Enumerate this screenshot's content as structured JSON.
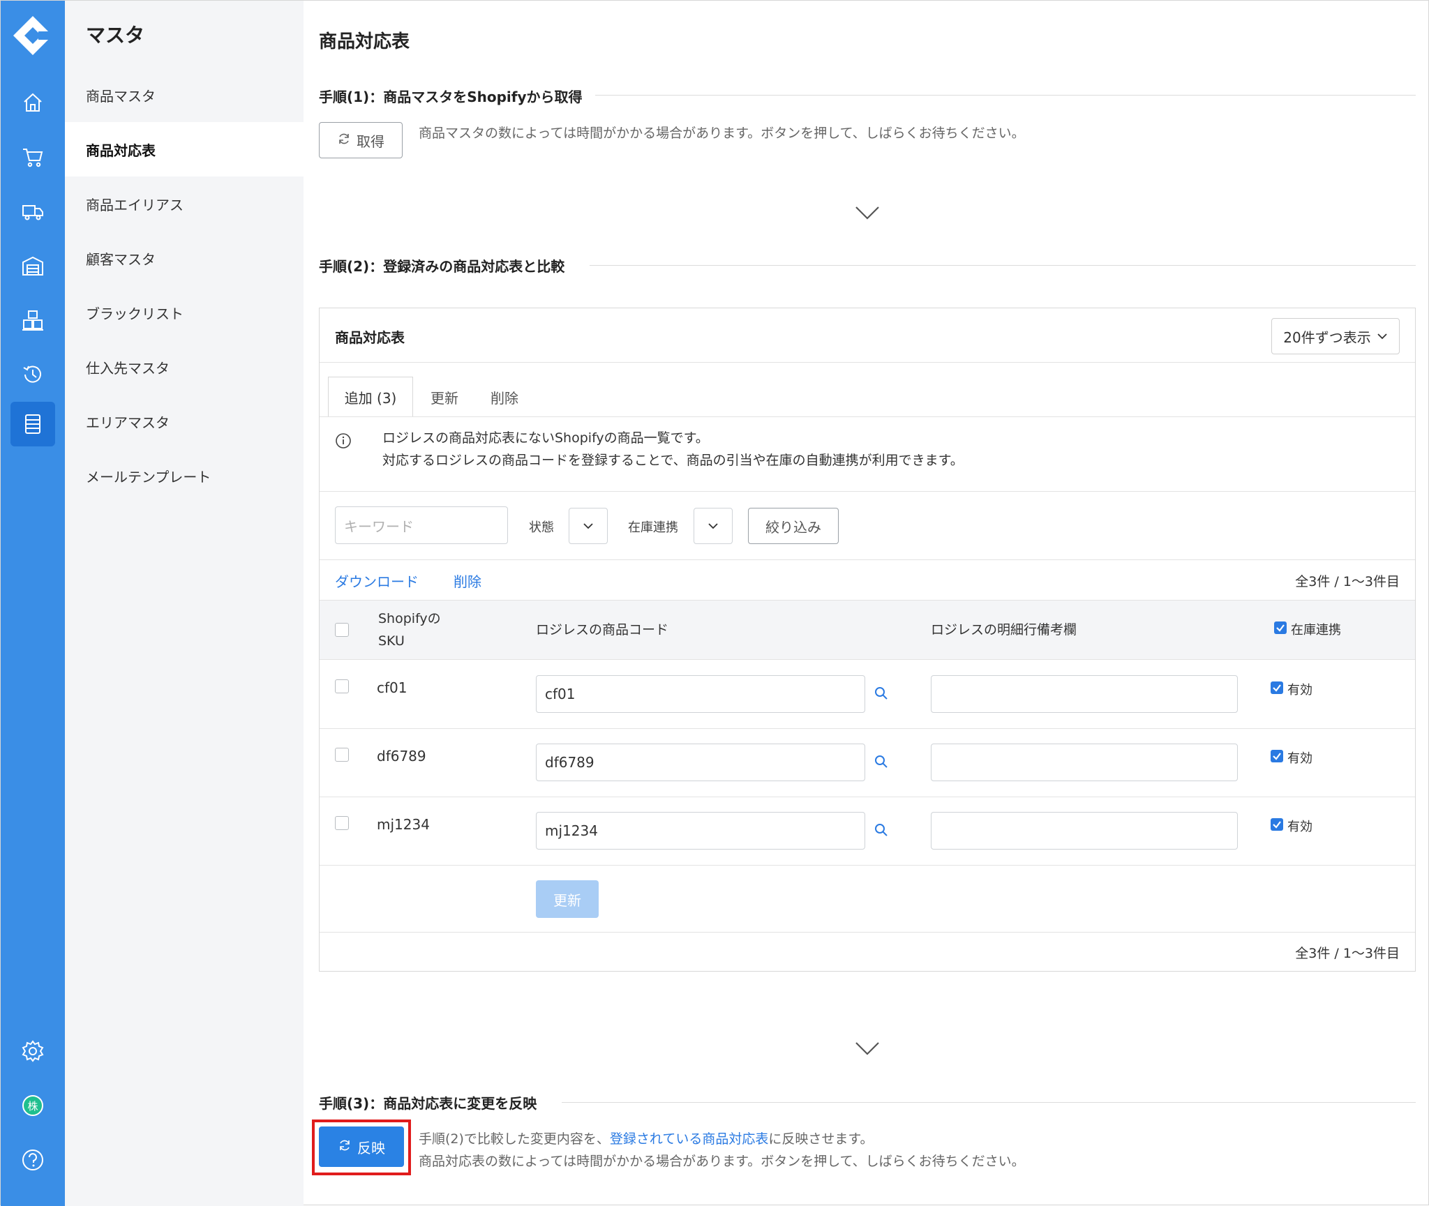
{
  "menu": {
    "title": "マスタ",
    "items": [
      {
        "label": "商品マスタ"
      },
      {
        "label": "商品対応表"
      },
      {
        "label": "商品エイリアス"
      },
      {
        "label": "顧客マスタ"
      },
      {
        "label": "ブラックリスト"
      },
      {
        "label": "仕入先マスタ"
      },
      {
        "label": "エリアマスタ"
      },
      {
        "label": "メールテンプレート"
      }
    ]
  },
  "rail": {
    "avatar_text": "株",
    "icons": [
      "home-icon",
      "cart-icon",
      "truck-icon",
      "warehouse-icon",
      "boxes-icon",
      "history-icon",
      "list-icon",
      "gear-icon",
      "help-icon"
    ]
  },
  "page": {
    "title": "商品対応表",
    "step1": {
      "heading": "手順(1)：商品マスタをShopifyから取得",
      "button": "取得",
      "note": "商品マスタの数によっては時間がかかる場合があります。ボタンを押して、しばらくお待ちください。"
    },
    "step2": {
      "heading": "手順(2)：登録済みの商品対応表と比較"
    },
    "step3": {
      "heading": "手順(3)：商品対応表に変更を反映",
      "button": "反映",
      "note_prefix": "手順(2)で比較した変更内容を、",
      "note_link": "登録されている商品対応表",
      "note_suffix": "に反映させます。",
      "note_line2": "商品対応表の数によっては時間がかかる場合があります。ボタンを押して、しばらくお待ちください。"
    }
  },
  "panel": {
    "title": "商品対応表",
    "per_page": "20件ずつ表示",
    "tabs": [
      {
        "label": "追加 (3)"
      },
      {
        "label": "更新"
      },
      {
        "label": "削除"
      }
    ],
    "info_line1": "ロジレスの商品対応表にないShopifyの商品一覧です。",
    "info_line2": "対応するロジレスの商品コードを登録することで、商品の引当や在庫の自動連携が利用できます。",
    "filter": {
      "keyword_placeholder": "キーワード",
      "status_label": "状態",
      "stock_label": "在庫連携",
      "filter_button": "絞り込み"
    },
    "actions": {
      "download": "ダウンロード",
      "delete": "削除"
    },
    "count_text": "全3件 / 1〜3件目",
    "columns": {
      "sku_line1": "Shopifyの",
      "sku_line2": "SKU",
      "code": "ロジレスの商品コード",
      "remark": "ロジレスの明細行備考欄",
      "stock": "在庫連携"
    },
    "rows": [
      {
        "sku": "cf01",
        "code": "cf01",
        "remark": "",
        "stock": "有効"
      },
      {
        "sku": "df6789",
        "code": "df6789",
        "remark": "",
        "stock": "有効"
      },
      {
        "sku": "mj1234",
        "code": "mj1234",
        "remark": "",
        "stock": "有効"
      }
    ],
    "update_button": "更新"
  },
  "colors": {
    "rail": "#3a8ee6",
    "accent": "#2a82e4",
    "highlight": "#e01c1c"
  }
}
